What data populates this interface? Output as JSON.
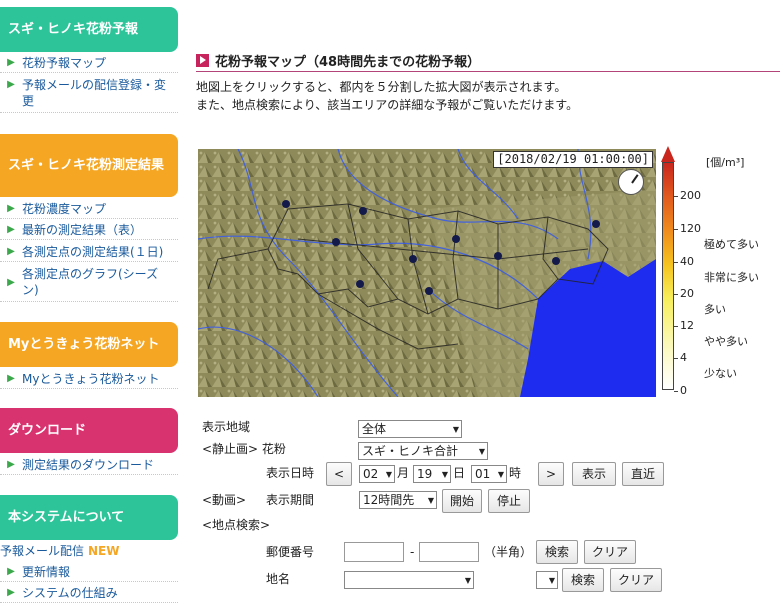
{
  "sidebar": {
    "sections": [
      {
        "title": "スギ・ヒノキ花粉予報",
        "color": "#2ec49a",
        "items": [
          "花粉予報マップ",
          "予報メールの配信登録・変更"
        ]
      },
      {
        "title": "スギ・ヒノキ花粉測定結果",
        "color": "#f5a623",
        "items": [
          "花粉濃度マップ",
          "最新の測定結果（表）",
          "各測定点の測定結果(１日)",
          "各測定点のグラフ(シーズン)"
        ]
      },
      {
        "title": "Myとうきょう花粉ネット",
        "color": "#f5a623",
        "items": [
          "Myとうきょう花粉ネット"
        ]
      },
      {
        "title": "ダウンロード",
        "color": "#d9336f",
        "items": [
          "測定結果のダウンロード"
        ]
      },
      {
        "title": "本システムについて",
        "color": "#2ec49a",
        "items": [
          "更新情報",
          "システムの仕組み"
        ]
      }
    ],
    "mail_label": "予報メール配信",
    "new_badge": "NEW"
  },
  "main": {
    "title": "花粉予報マップ（48時間先までの花粉予報）",
    "desc_line1": "地図上をクリックすると、都内を５分割した拡大図が表示されます。",
    "desc_line2": "また、地点検索により、該当エリアの詳細な予報がご覧いただけます。",
    "timestamp": "[2018/02/19 01:00:00]"
  },
  "legend": {
    "unit": "[個/m³]",
    "ticks": [
      "200",
      "120",
      "40",
      "20",
      "12",
      "4",
      "0"
    ],
    "levels": [
      "極めて多い",
      "非常に多い",
      "多い",
      "やや多い",
      "少ない"
    ]
  },
  "controls": {
    "area_label": "表示地域",
    "area_value": "全体",
    "still_label": "<静止画> 花粉",
    "pollen_value": "スギ・ヒノキ合計",
    "date_label": "表示日時",
    "prev_btn": "<",
    "month": "02",
    "month_unit": "月",
    "day": "19",
    "day_unit": "日",
    "hour": "01",
    "hour_unit": "時",
    "next_btn": ">",
    "show_btn": "表示",
    "latest_btn": "直近",
    "anim_label": "<動画>",
    "period_label": "表示期間",
    "period_value": "12時間先",
    "start_btn": "開始",
    "stop_btn": "停止",
    "search_label": "<地点検索>",
    "postal_label": "郵便番号",
    "postal_sep": "-",
    "postal_note": "（半角）",
    "search_btn": "検索",
    "clear_btn": "クリア",
    "place_label": "地名"
  }
}
